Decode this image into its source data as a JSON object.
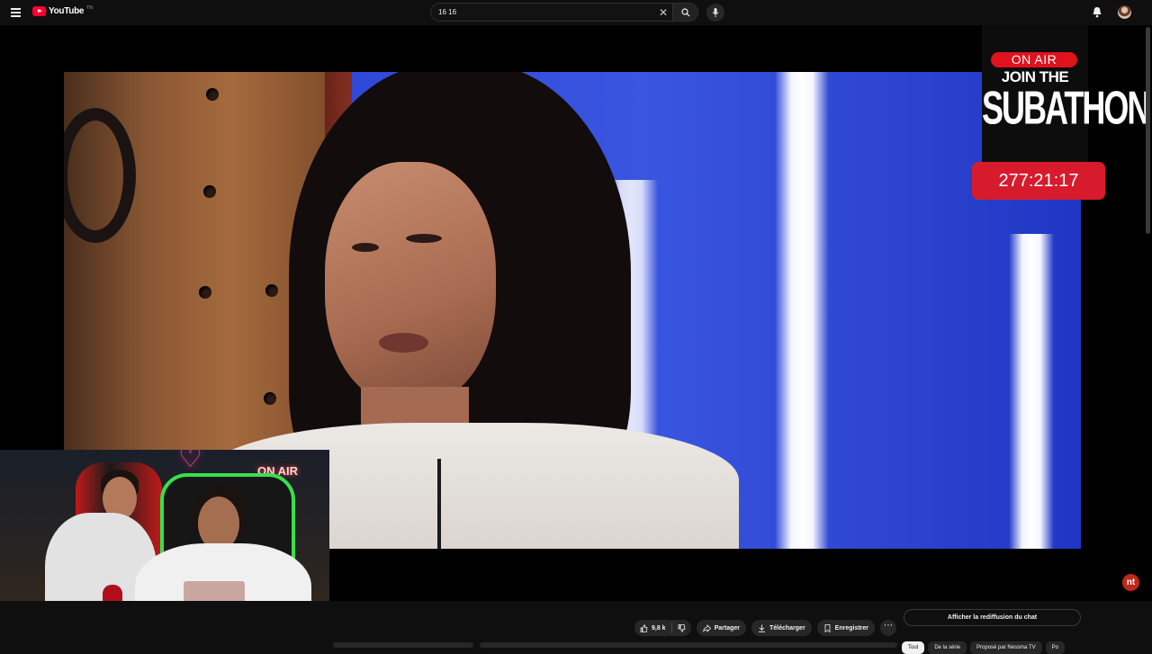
{
  "header": {
    "logo_text": "YouTube",
    "logo_region": "TN",
    "search_value": "16 16",
    "icons": [
      "menu-icon",
      "youtube-logo-icon",
      "close-icon",
      "search-icon",
      "microphone-icon",
      "bell-icon"
    ]
  },
  "overlay": {
    "onair_label": "ON AIR",
    "join_label": "JOIN THE",
    "subathon_label": "SUBATHON",
    "timer": "277:21:17",
    "webcam_sign": "ON AIR",
    "accent_color": "#e0121c"
  },
  "actions": {
    "likes": "9,8 k",
    "share": "Partager",
    "download": "Télécharger",
    "save": "Enregistrer"
  },
  "chat": {
    "replay_label": "Afficher la rediffusion du chat"
  },
  "chips": [
    "Tout",
    "De la série",
    "Proposé par Nessma TV",
    "Po"
  ]
}
